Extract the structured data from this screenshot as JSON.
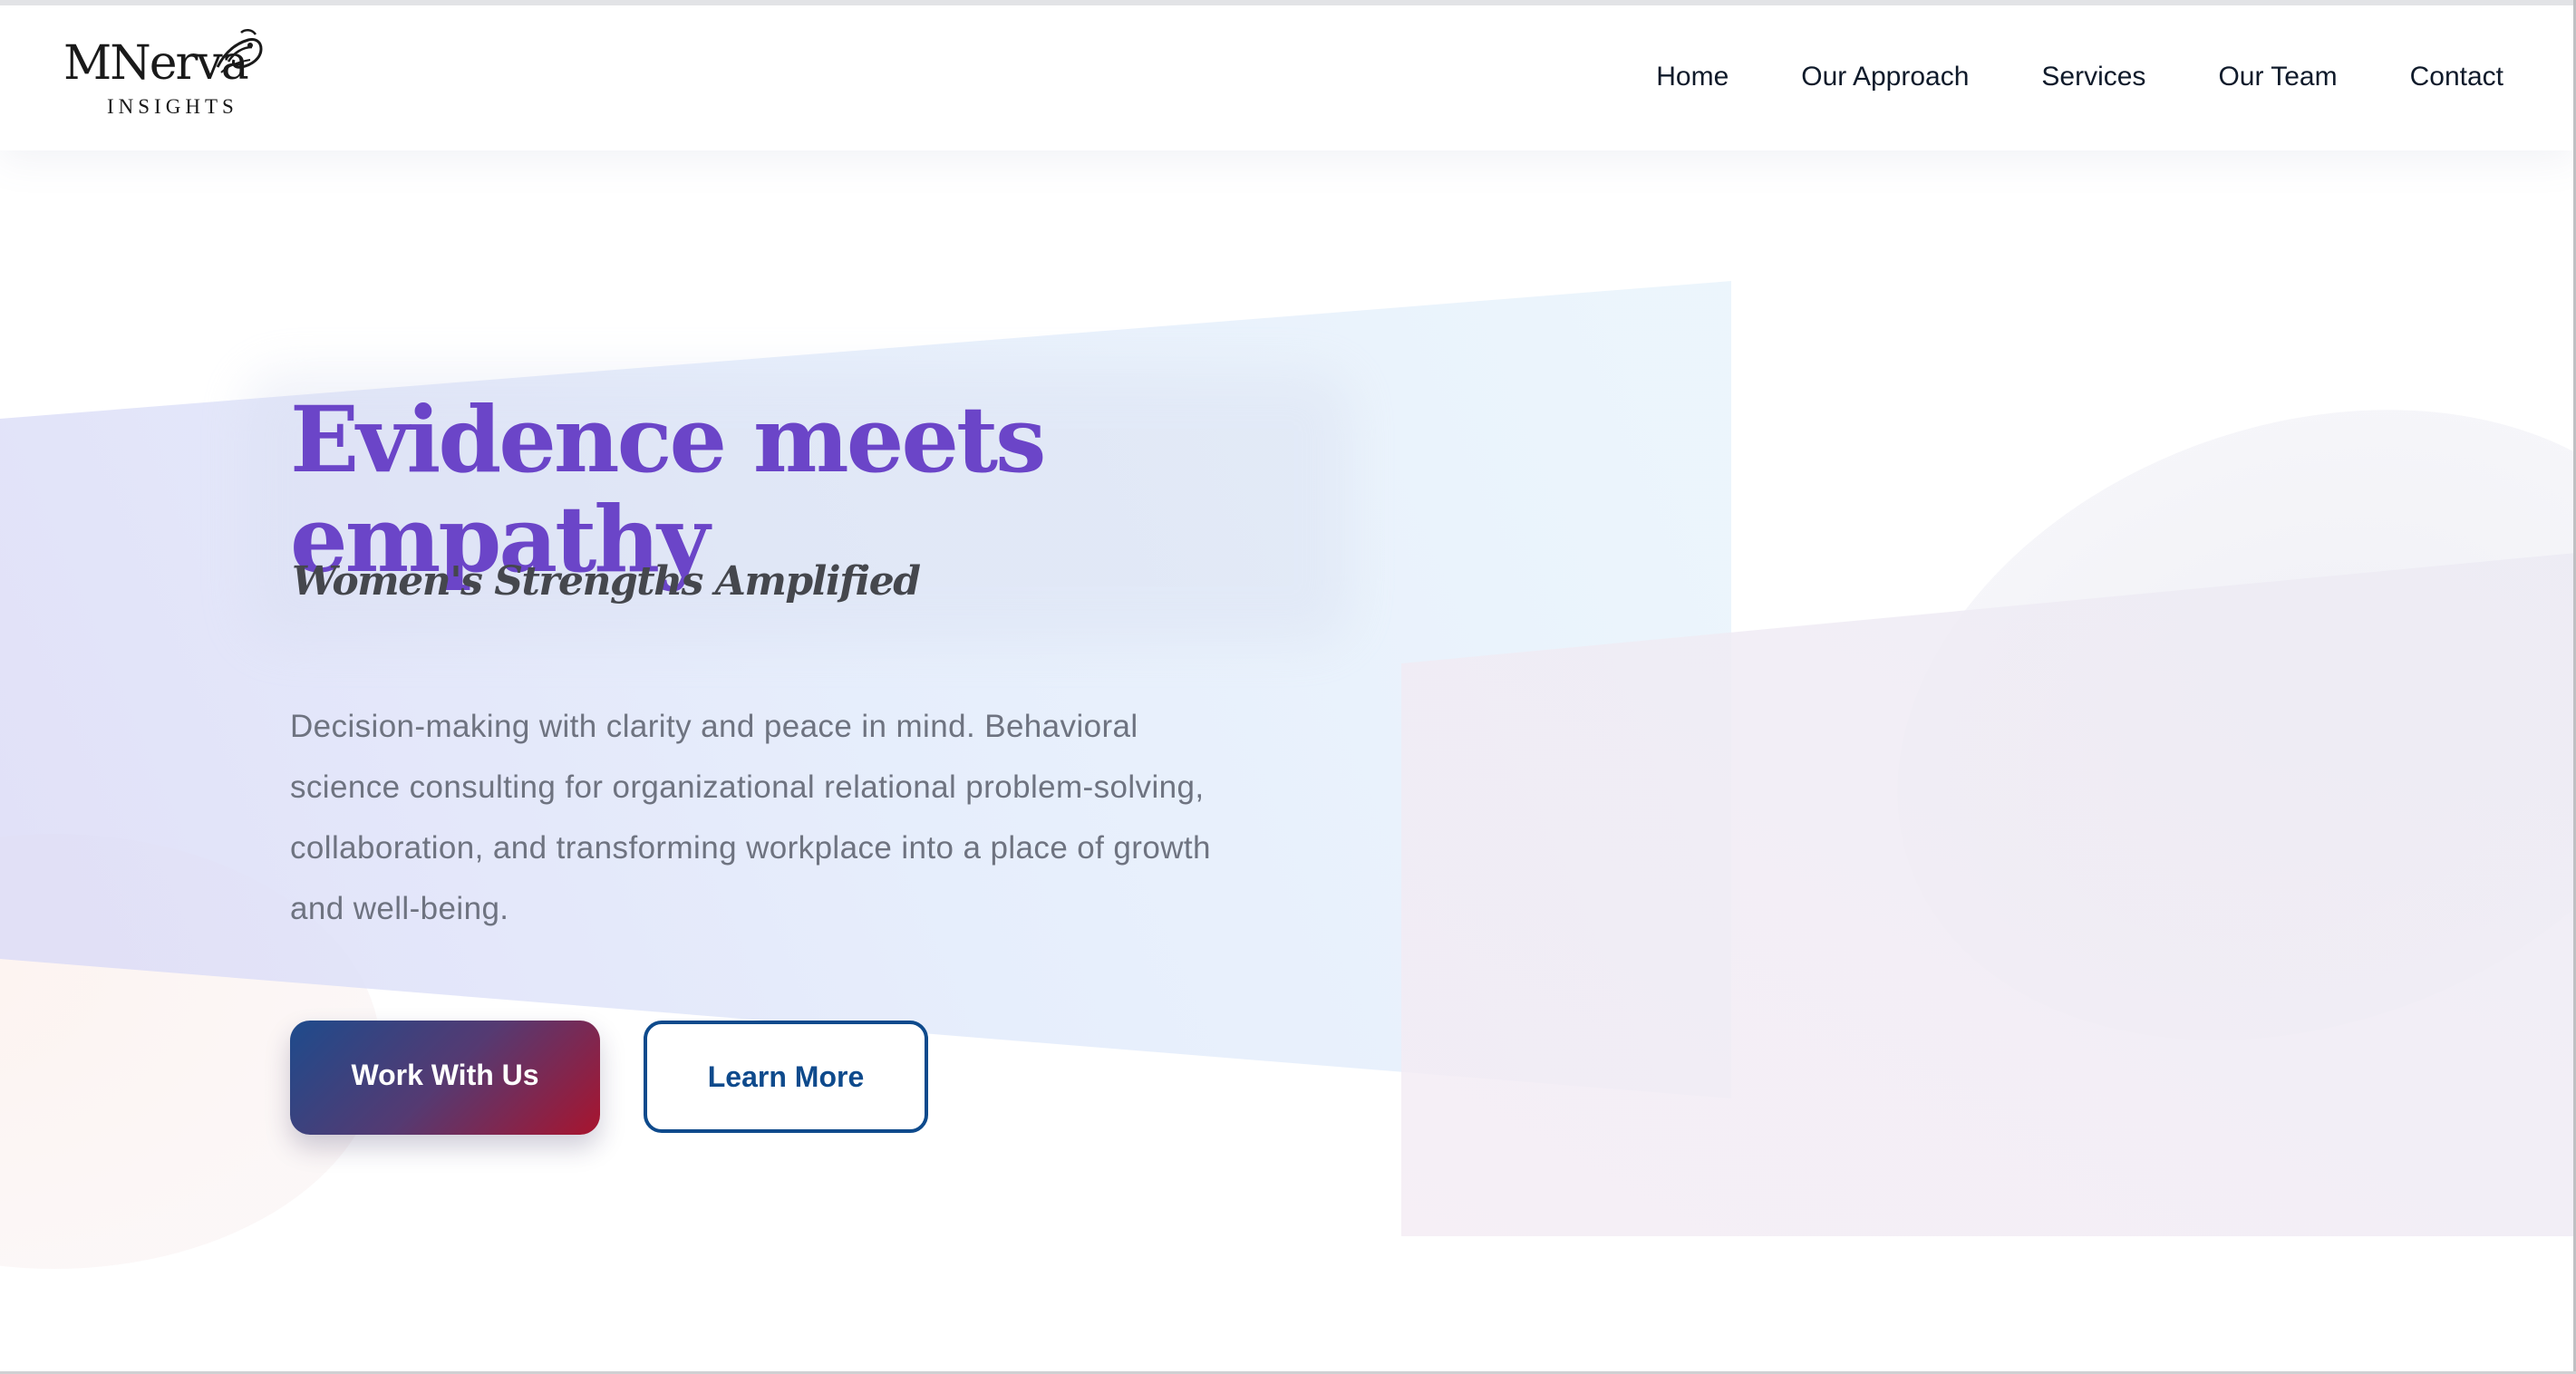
{
  "header": {
    "logo": {
      "wordmark": "MNerva",
      "subtitle": "INSIGHTS"
    },
    "nav": {
      "items": [
        {
          "label": "Home"
        },
        {
          "label": "Our Approach"
        },
        {
          "label": "Services"
        },
        {
          "label": "Our Team"
        },
        {
          "label": "Contact"
        }
      ]
    }
  },
  "hero": {
    "title": "Evidence meets empathy",
    "subtitle": "Women's Strengths Amplified",
    "description": "Decision-making with clarity and peace in mind. Behavioral science consulting for organizational relational problem-solving, collaboration, and transforming workplace into a place of growth and well-being.",
    "buttons": {
      "primary_label": "Work With Us",
      "secondary_label": "Learn More"
    }
  },
  "colors": {
    "title_purple": "#6b45c8",
    "button_gradient_start": "#1e4b8c",
    "button_gradient_end": "#a8142e",
    "outline_blue": "#0e4a8c",
    "nav_text": "#0f1a2a"
  },
  "icons": {
    "logo_mark": "owl-logo-icon"
  }
}
